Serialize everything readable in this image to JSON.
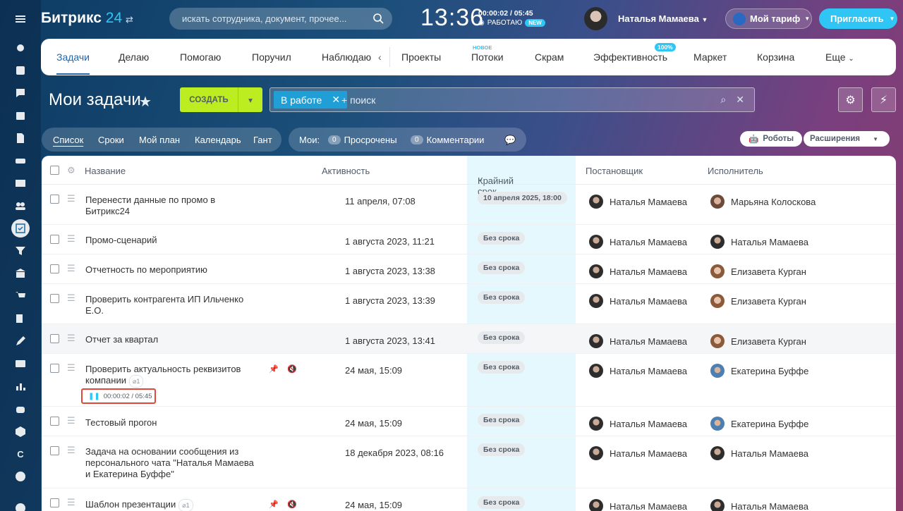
{
  "app": {
    "logo": "Битрикс",
    "logo_num": "24",
    "search_placeholder": "искать сотрудника, документ, прочее...",
    "clock": "13:36",
    "timer": "00:00:02 / 05:45",
    "status": "РАБОТАЮ",
    "new_badge": "NEW",
    "user": "Наталья Мамаева",
    "tariff": "Мой тариф",
    "invite": "Пригласить"
  },
  "nav": {
    "items": [
      "Задачи",
      "Делаю",
      "Помогаю",
      "Поручил",
      "Наблюдаю",
      "Проекты",
      "Потоки",
      "Скрам",
      "Эффективность",
      "Маркет",
      "Корзина",
      "Еще"
    ],
    "new_label": "НОВОЕ",
    "percent": "100%"
  },
  "page": {
    "title": "Мои задачи",
    "create": "СОЗДАТЬ",
    "filter_chip": "В работе",
    "filter_placeholder": "+ поиск"
  },
  "views": [
    "Список",
    "Сроки",
    "Мой план",
    "Календарь",
    "Гант"
  ],
  "counters": {
    "label": "Мои:",
    "overdue_count": "0",
    "overdue": "Просрочены",
    "comments_count": "0",
    "comments": "Комментарии"
  },
  "extras": {
    "robots": "Роботы",
    "extensions": "Расширения"
  },
  "table": {
    "headers": {
      "name": "Название",
      "activity": "Активность",
      "deadline": "Крайний срок",
      "creator": "Постановщик",
      "responsible": "Исполнитель"
    },
    "rows": [
      {
        "title": "Перенести данные по промо в Битрикс24",
        "activity": "11 апреля, 07:08",
        "deadline": "10 апреля 2025, 18:00",
        "creator": "Наталья Мамаева",
        "responsible": "Марьяна Колоскова"
      },
      {
        "title": "Промо-сценарий",
        "activity": "1 августа 2023, 11:21",
        "deadline": "Без срока",
        "creator": "Наталья Мамаева",
        "responsible": "Наталья Мамаева"
      },
      {
        "title": "Отчетность по мероприятию",
        "activity": "1 августа 2023, 13:38",
        "deadline": "Без срока",
        "creator": "Наталья Мамаева",
        "responsible": "Елизавета Курган"
      },
      {
        "title": "Проверить контрагента ИП Ильченко Е.О.",
        "activity": "1 августа 2023, 13:39",
        "deadline": "Без срока",
        "creator": "Наталья Мамаева",
        "responsible": "Елизавета Курган"
      },
      {
        "title": "Отчет за квартал",
        "activity": "1 августа 2023, 13:41",
        "deadline": "Без срока",
        "creator": "Наталья Мамаева",
        "responsible": "Елизавета Курган"
      },
      {
        "title": "Проверить актуальность реквизитов компании",
        "activity": "24 мая, 15:09",
        "deadline": "Без срока",
        "creator": "Наталья Мамаева",
        "responsible": "Екатерина Буффе",
        "attachments": "1",
        "timer": "00:00:02 / 05:45"
      },
      {
        "title": "Тестовый прогон",
        "activity": "24 мая, 15:09",
        "deadline": "Без срока",
        "creator": "Наталья Мамаева",
        "responsible": "Екатерина Буффе"
      },
      {
        "title": "Задача на основании сообщения из персонального чата \"Наталья Мамаева и Екатерина Буффе\"",
        "activity": "18 декабря 2023, 08:16",
        "deadline": "Без срока",
        "creator": "Наталья Мамаева",
        "responsible": "Наталья Мамаева"
      },
      {
        "title": "Шаблон презентации",
        "activity": "24 мая, 15:09",
        "deadline": "Без срока",
        "creator": "Наталья Мамаева",
        "responsible": "Наталья Мамаева",
        "attachments": "1"
      }
    ]
  },
  "colors": {
    "accent": "#2fc6f6",
    "create": "#bbed21",
    "nav_active": "#2067b0",
    "timer_outline": "#e2473b"
  }
}
